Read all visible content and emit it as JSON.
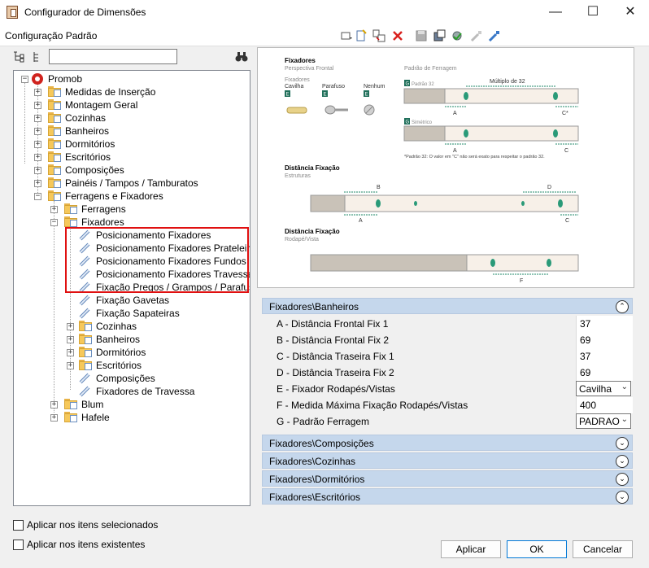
{
  "window": {
    "title": "Configurador de Dimensões",
    "minimize": "—",
    "maximize": "☐",
    "close": "✕"
  },
  "toolbar": {
    "config_label": "Configuração Padrão"
  },
  "tree": {
    "search_placeholder": "",
    "root": "Promob",
    "items": {
      "medidas": "Medidas de Inserção",
      "montagem": "Montagem Geral",
      "cozinhas": "Cozinhas",
      "banheiros": "Banheiros",
      "dormitorios": "Dormitórios",
      "escritorios": "Escritórios",
      "composicoes": "Composições",
      "paineis": "Painéis / Tampos / Tamburatos",
      "ferragens_fixadores": "Ferragens e Fixadores",
      "ferragens": "Ferragens",
      "fixadores": "Fixadores",
      "pos_fix": "Posicionamento Fixadores",
      "pos_prat": "Posicionamento Fixadores Prateleiras",
      "pos_fundos": "Posicionamento Fixadores Fundos",
      "pos_trav": "Posicionamento Fixadores Travessas",
      "fix_pregos": "Fixação Pregos / Grampos / Parafusos",
      "fix_gavetas": "Fixação Gavetas",
      "fix_sapateiras": "Fixação Sapateiras",
      "sub_cozinhas": "Cozinhas",
      "sub_banheiros": "Banheiros",
      "sub_dormitorios": "Dormitórios",
      "sub_escritorios": "Escritórios",
      "sub_composicoes": "Composições",
      "fix_travessa": "Fixadores de Travessa",
      "blum": "Blum",
      "hafele": "Hafele"
    }
  },
  "preview": {
    "fix_title": "Fixadores",
    "fix_sub": "Perspectiva Frontal",
    "fix_label": "Fixadores",
    "cavilha": "Cavilha",
    "parafuso": "Parafuso",
    "nenhum": "Nenhum",
    "e": "E",
    "g": "G",
    "padrao_ferragem": "Padrão de Ferragem",
    "padrao32": "Padrão 32",
    "multiplo": "Múltiplo de 32",
    "simetrico": "Simétrico",
    "note": "*Padrão 32: O valor em \"C\" não será exato para respeitar o padrão 32.",
    "a": "A",
    "b": "B",
    "c": "C",
    "cstar": "C*",
    "d": "D",
    "f": "F",
    "dist_title": "Distância Fixação",
    "dist_sub": "Estruturas",
    "dist2_title": "Distância Fixação",
    "dist2_sub": "Rodapé/Vista"
  },
  "groups": {
    "banheiros": "Fixadores\\Banheiros",
    "composicoes": "Fixadores\\Composições",
    "cozinhas": "Fixadores\\Cozinhas",
    "dormitorios": "Fixadores\\Dormitórios",
    "escritorios": "Fixadores\\Escritórios",
    "collapse": "⌃",
    "expand": "⌄"
  },
  "properties": [
    {
      "label": "A - Distância Frontal Fix 1",
      "value": "37"
    },
    {
      "label": "B - Distância Frontal Fix 2",
      "value": "69"
    },
    {
      "label": "C - Distância Traseira Fix 1",
      "value": "37"
    },
    {
      "label": "D - Distância Traseira Fix 2",
      "value": "69"
    },
    {
      "label": "E - Fixador Rodapés/Vistas",
      "value": "Cavilha"
    },
    {
      "label": "F - Medida Máxima Fixação Rodapés/Vistas",
      "value": "400"
    },
    {
      "label": "G - Padrão Ferragem",
      "value": "PADRAO"
    }
  ],
  "footer": {
    "apply_selected": "Aplicar nos itens selecionados",
    "apply_existing": "Aplicar nos itens existentes",
    "apply": "Aplicar",
    "ok": "OK",
    "cancel": "Cancelar"
  }
}
